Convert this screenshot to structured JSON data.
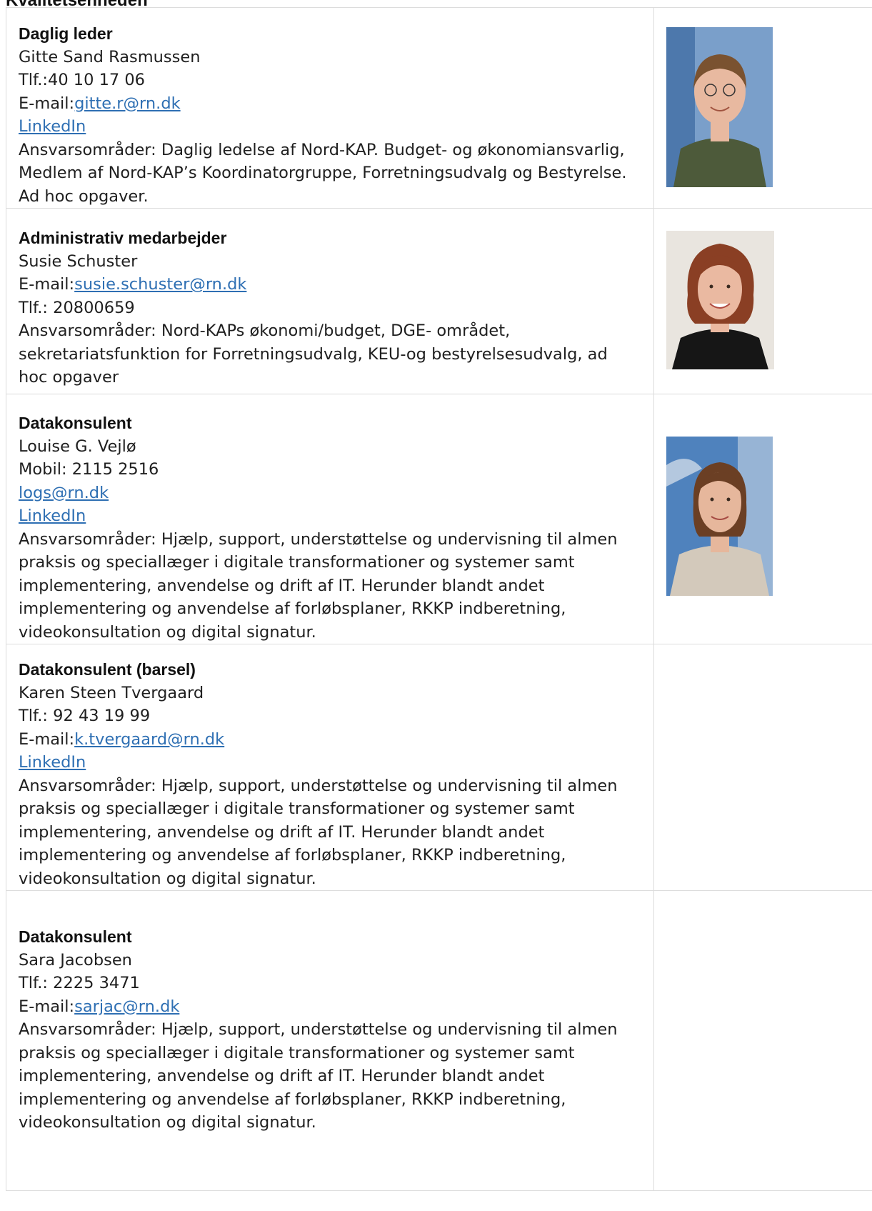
{
  "page": {
    "heading": "Kvalitetsenheden"
  },
  "staff": [
    {
      "role": "Daglig leder",
      "name": "Gitte Sand Rasmussen",
      "lines": [
        {
          "prefix": "Tlf.:",
          "value": "40 10 17 06",
          "link": false
        },
        {
          "prefix": "E-mail:",
          "value": "gitte.r@rn.dk",
          "link": true
        },
        {
          "prefix": "",
          "value": "LinkedIn",
          "link": true
        }
      ],
      "responsibilities": "Ansvarsområder: Daglig ledelse af Nord-KAP. Budget- og økonomiansvarlig, Medlem af Nord-KAP’s Koordinatorgruppe, Forretningsudvalg og Bestyrelse. Ad hoc opgaver.",
      "photo": {
        "icon": "portrait-photo-gitte",
        "background": "#3f75b4",
        "hair": "#7a5230",
        "clothing": "#4d5a3a",
        "skin": "#e8b9a0"
      }
    },
    {
      "role": "Administrativ medarbejder",
      "name": "Susie Schuster",
      "lines": [
        {
          "prefix": "E-mail:",
          "value": "susie.schuster@rn.dk",
          "link": true
        },
        {
          "prefix": "Tlf.: ",
          "value": "20800659",
          "link": false
        }
      ],
      "responsibilities": "Ansvarsområder: Nord-KAPs økonomi/budget, DGE- området, sekretariatsfunktion for Forretningsudvalg, KEU-og bestyrelsesudvalg, ad hoc opgaver",
      "photo": {
        "icon": "portrait-photo-susie",
        "background": "#e9e5df",
        "hair": "#8a3f24",
        "clothing": "#161616",
        "skin": "#eab9a1"
      }
    },
    {
      "role": "Datakonsulent",
      "name": "Louise G. Vejlø",
      "lines": [
        {
          "prefix": "Mobil: ",
          "value": "2115 2516",
          "link": false
        },
        {
          "prefix": "",
          "value": "logs@rn.dk",
          "link": true
        },
        {
          "prefix": "",
          "value": "LinkedIn",
          "link": true
        }
      ],
      "responsibilities": "Ansvarsområder: Hjælp, support, understøttelse og undervisning til almen praksis og speciallæger i digitale transformationer og systemer samt implementering, anvendelse og drift af IT. Herunder blandt andet implementering og anvendelse af forløbsplaner, RKKP indberetning, videokonsultation og digital signatur.",
      "photo": {
        "icon": "portrait-photo-louise",
        "background": "#4f82bd",
        "hair": "#6b3f24",
        "clothing": "#d3c9bb",
        "skin": "#e6b79c"
      }
    },
    {
      "role": "Datakonsulent (barsel)",
      "name": "Karen Steen Tvergaard",
      "lines": [
        {
          "prefix": "Tlf.: ",
          "value": "92 43 19 99",
          "link": false
        },
        {
          "prefix": "E-mail:",
          "value": "k.tvergaard@rn.dk",
          "link": true
        },
        {
          "prefix": "",
          "value": "LinkedIn",
          "link": true
        }
      ],
      "responsibilities": "Ansvarsområder: Hjælp, support, understøttelse og undervisning til almen praksis og speciallæger i digitale transformationer og systemer samt implementering, anvendelse og drift af IT. Herunder blandt andet implementering og anvendelse af forløbsplaner, RKKP indberetning, videokonsultation og digital signatur.",
      "photo": null
    },
    {
      "role": "Datakonsulent",
      "name": "Sara Jacobsen",
      "lines": [
        {
          "prefix": "Tlf.: ",
          "value": "2225 3471",
          "link": false
        },
        {
          "prefix": "E-mail:",
          "value": "sarjac@rn.dk",
          "link": true
        }
      ],
      "responsibilities": "Ansvarsområder: Hjælp, support, understøttelse og undervisning til almen praksis og speciallæger i digitale transformationer og systemer samt implementering, anvendelse og drift af IT. Herunder blandt andet implementering og anvendelse af forløbsplaner, RKKP indberetning, videokonsultation og digital signatur.",
      "photo": null
    }
  ],
  "colors": {
    "link": "#2e6fb3",
    "border": "#dcdcdc",
    "text": "#1f1f1f"
  }
}
